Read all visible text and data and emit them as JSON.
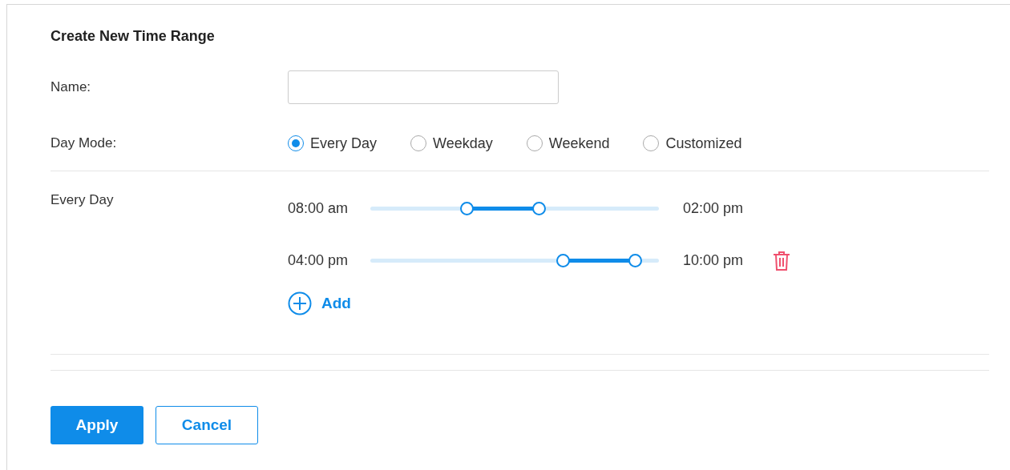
{
  "title": "Create New Time Range",
  "name_field": {
    "label": "Name:"
  },
  "day_mode": {
    "label": "Day Mode:",
    "options": [
      {
        "label": "Every Day",
        "selected": true
      },
      {
        "label": "Weekday",
        "selected": false
      },
      {
        "label": "Weekend",
        "selected": false
      },
      {
        "label": "Customized",
        "selected": false
      }
    ]
  },
  "schedule": {
    "label": "Every Day",
    "ranges": [
      {
        "start": "08:00 am",
        "end": "02:00 pm",
        "thumbs": [
          {
            "level": 0.333
          },
          {
            "level": 0.583
          }
        ],
        "deletable": false
      },
      {
        "start": "04:00 pm",
        "end": "10:00 pm",
        "thumbs": [
          {
            "level": 0.667
          },
          {
            "level": 0.917
          }
        ],
        "deletable": true
      }
    ],
    "add_label": "Add"
  },
  "buttons": [
    {
      "label": "Apply",
      "kind": "primary"
    },
    {
      "label": "Cancel",
      "kind": "secondary"
    }
  ]
}
